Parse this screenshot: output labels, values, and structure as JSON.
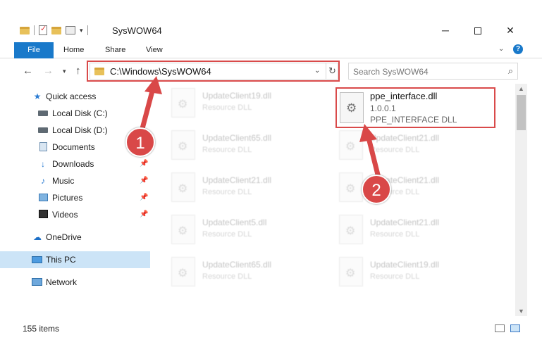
{
  "window": {
    "title": "SysWOW64",
    "minimize_label": "─",
    "close_label": "✕"
  },
  "ribbon": {
    "file": "File",
    "home": "Home",
    "share": "Share",
    "view": "View",
    "help": "?"
  },
  "navbar": {
    "back": "←",
    "forward": "→",
    "recent": "▾",
    "up": "↑",
    "address": "C:\\Windows\\SysWOW64",
    "address_dropdown": "⌄",
    "refresh": "↻",
    "search_placeholder": "Search SysWOW64",
    "search_icon": "⌕"
  },
  "sidebar": {
    "items": [
      {
        "label": "Quick access",
        "icon": "star-icon"
      },
      {
        "label": "Local Disk (C:)",
        "icon": "drive-icon"
      },
      {
        "label": "Local Disk (D:)",
        "icon": "drive-icon"
      },
      {
        "label": "Documents",
        "icon": "documents-icon"
      },
      {
        "label": "Downloads",
        "icon": "download-icon",
        "pinned": true
      },
      {
        "label": "Music",
        "icon": "music-icon",
        "pinned": true
      },
      {
        "label": "Pictures",
        "icon": "pictures-icon",
        "pinned": true
      },
      {
        "label": "Videos",
        "icon": "videos-icon",
        "pinned": true
      },
      {
        "label": "OneDrive",
        "icon": "cloud-icon"
      },
      {
        "label": "This PC",
        "icon": "computer-icon",
        "selected": true
      },
      {
        "label": "Network",
        "icon": "network-icon"
      }
    ]
  },
  "files": {
    "highlighted": {
      "name": "ppe_interface.dll",
      "version": "1.0.0.1",
      "type": "PPE_INTERFACE DLL"
    },
    "blurred": [
      {
        "name": "UpdateClient19.dll",
        "type": "Resource DLL"
      },
      {
        "name": "UpdateClient65.dll",
        "type": "Resource DLL"
      },
      {
        "name": "UpdateClient21.dll",
        "type": "Resource DLL"
      },
      {
        "name": "UpdateClient5.dll",
        "type": "Resource DLL"
      },
      {
        "name": "UpdateClient65.dll",
        "type": "Resource DLL"
      },
      {
        "name": "UpdateClient21.dll",
        "type": "Resource DLL"
      },
      {
        "name": "UpdateClient21.dll",
        "type": "Resource DLL"
      },
      {
        "name": "UpdateClient21.dll",
        "type": "Resource DLL"
      },
      {
        "name": "UpdateClient19.dll",
        "type": "Resource DLL"
      }
    ]
  },
  "status": {
    "item_count": "155 items"
  },
  "annotations": {
    "step1": "1",
    "step2": "2",
    "color": "#d94848"
  },
  "colors": {
    "accent": "#1979ca",
    "highlight_border": "#d94a4a",
    "selected_bg": "#cce4f7"
  }
}
